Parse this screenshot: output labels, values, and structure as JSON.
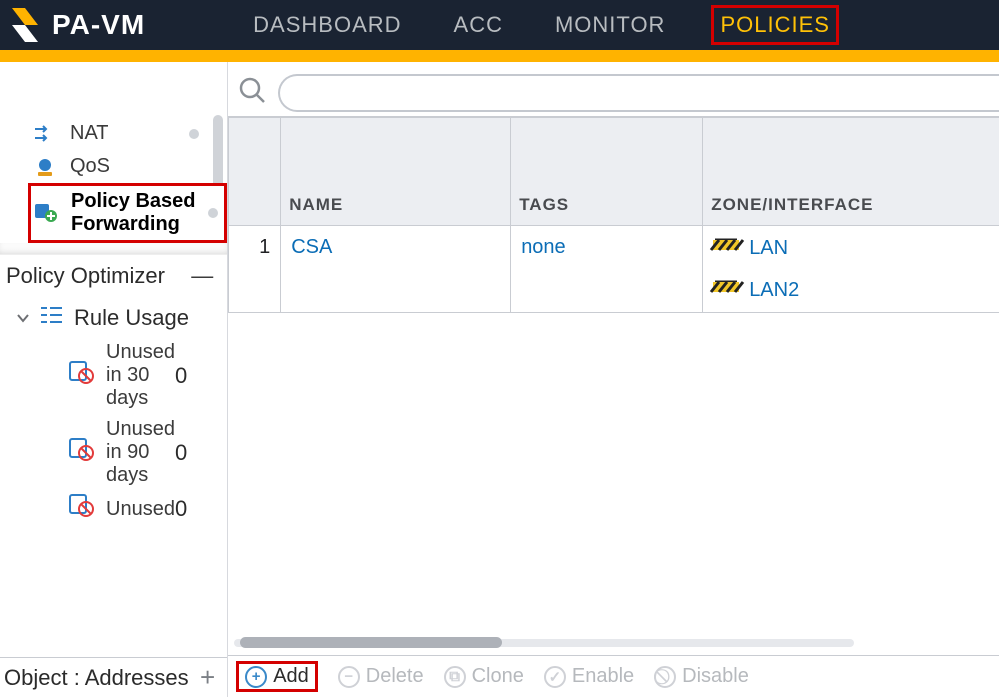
{
  "brand": {
    "name": "PA-VM"
  },
  "nav": {
    "items": [
      {
        "label": "DASHBOARD"
      },
      {
        "label": "ACC"
      },
      {
        "label": "MONITOR"
      },
      {
        "label": "POLICIES",
        "active": true
      }
    ]
  },
  "sidebar": {
    "items": [
      {
        "label": "NAT",
        "icon": "nat"
      },
      {
        "label": "QoS",
        "icon": "qos"
      },
      {
        "label": "Policy Based Forwarding",
        "icon": "pbf",
        "selected": true
      }
    ]
  },
  "policy_optimizer": {
    "title": "Policy Optimizer",
    "collapse_glyph": "—",
    "rule_usage": {
      "label": "Rule Usage",
      "children": [
        {
          "label": "Unused in 30 days",
          "count": "0"
        },
        {
          "label": "Unused in 90 days",
          "count": "0"
        },
        {
          "label": "Unused",
          "count": "0"
        }
      ]
    }
  },
  "object_row": {
    "label": "Object : Addresses",
    "plus_glyph": "+"
  },
  "search": {
    "placeholder": ""
  },
  "table": {
    "headers": {
      "name": "NAME",
      "tags": "TAGS",
      "zone": "ZONE/INTERFACE"
    },
    "rows": [
      {
        "num": "1",
        "name": "CSA",
        "tags": "none",
        "zones": [
          {
            "label": "LAN"
          },
          {
            "label": "LAN2"
          }
        ]
      }
    ]
  },
  "toolbar": {
    "add": "Add",
    "delete": "Delete",
    "clone": "Clone",
    "enable": "Enable",
    "disable": "Disable"
  }
}
